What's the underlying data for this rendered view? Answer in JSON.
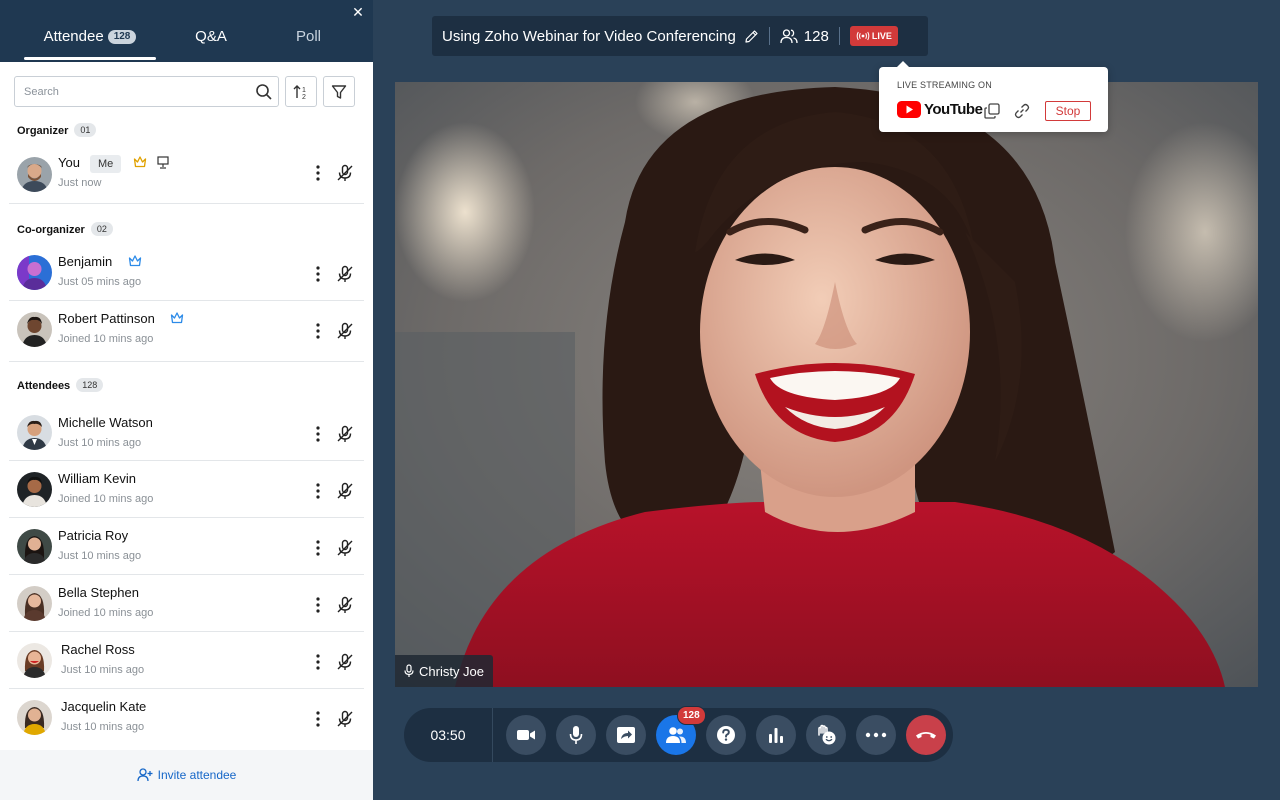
{
  "panel": {
    "close_icon": "close-icon",
    "tabs": [
      {
        "label": "Attendee",
        "count": "128"
      },
      {
        "label": "Q&A"
      },
      {
        "label": "Poll"
      }
    ],
    "search": {
      "placeholder": "Search",
      "icon": "search-icon"
    },
    "sort_icon": "sort-icon",
    "filter_icon": "filter-icon",
    "sections": {
      "organizer": {
        "label": "Organizer",
        "count": "01"
      },
      "coorganizer": {
        "label": "Co-organizer",
        "count": "02"
      },
      "attendees": {
        "label": "Attendees",
        "count": "128"
      }
    },
    "organizer": [
      {
        "name": "You",
        "badge": "Me",
        "time": "Just now"
      }
    ],
    "coorganizers": [
      {
        "name": "Benjamin",
        "time": "Just 05 mins ago"
      },
      {
        "name": "Robert Pattinson",
        "time": "Joined 10 mins ago"
      }
    ],
    "attendees": [
      {
        "name": "Michelle Watson",
        "time": "Just 10 mins ago"
      },
      {
        "name": "William Kevin",
        "time": "Joined 10 mins ago"
      },
      {
        "name": "Patricia Roy",
        "time": "Just 10 mins ago"
      },
      {
        "name": "Bella Stephen",
        "time": "Joined 10 mins ago"
      },
      {
        "name": "Rachel Ross",
        "time": "Just 10 mins ago"
      },
      {
        "name": "Jacquelin Kate",
        "time": "Just 10 mins ago"
      }
    ],
    "invite_label": "Invite attendee"
  },
  "header": {
    "title": "Using Zoho Webinar for Video Conferencing",
    "viewer_count": "128",
    "live_label": "LIVE"
  },
  "streaming": {
    "heading": "LIVE STREAMING ON",
    "platform": "YouTube",
    "stop_label": "Stop"
  },
  "video": {
    "speaker_name": "Christy Joe"
  },
  "controls": {
    "timer": "03:50",
    "participants_badge": "128"
  },
  "colors": {
    "brand_dark": "#1f3851",
    "accent_blue": "#1a76e8",
    "live_red": "#d23a3a",
    "background": "#2a4158"
  }
}
